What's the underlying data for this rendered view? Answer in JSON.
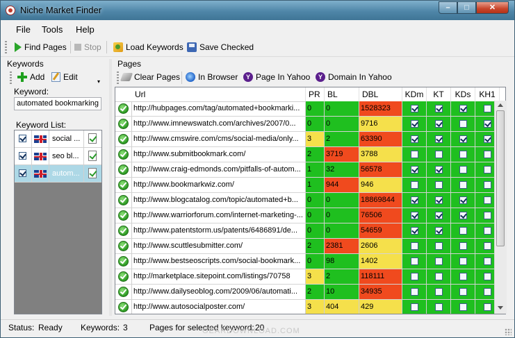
{
  "window": {
    "title": "Niche Market Finder"
  },
  "menu": [
    "File",
    "Tools",
    "Help"
  ],
  "toolbar": {
    "find_pages": "Find Pages",
    "stop": "Stop",
    "load_keywords": "Load Keywords",
    "save_checked": "Save Checked"
  },
  "keywords_panel": {
    "title": "Keywords",
    "add": "Add",
    "edit": "Edit",
    "keyword_label": "Keyword:",
    "keyword_value": "automated bookmarking",
    "list_label": "Keyword List:",
    "items": [
      {
        "text": "social ...",
        "checked": true,
        "selected": false
      },
      {
        "text": "seo bl...",
        "checked": true,
        "selected": false
      },
      {
        "text": "autom...",
        "checked": true,
        "selected": true
      }
    ]
  },
  "pages_panel": {
    "title": "Pages",
    "clear_pages": "Clear Pages",
    "in_browser": "In Browser",
    "page_in_yahoo": "Page In Yahoo",
    "domain_in_yahoo": "Domain In Yahoo",
    "columns": [
      "Url",
      "PR",
      "BL",
      "DBL",
      "KDm",
      "KT",
      "KDs",
      "KH1"
    ],
    "rows": [
      {
        "url": "http://hubpages.com/tag/automated+bookmarki...",
        "pr": "0",
        "bl": "0",
        "dbl": "1528323",
        "c": [
          "g",
          "g",
          "r"
        ],
        "kdm": true,
        "kt": true,
        "kds": true,
        "kh1": false
      },
      {
        "url": "http://www.imnewswatch.com/archives/2007/0...",
        "pr": "0",
        "bl": "0",
        "dbl": "9716",
        "c": [
          "g",
          "g",
          "y"
        ],
        "kdm": true,
        "kt": true,
        "kds": false,
        "kh1": true
      },
      {
        "url": "http://www.cmswire.com/cms/social-media/only...",
        "pr": "3",
        "bl": "2",
        "dbl": "63390",
        "c": [
          "y",
          "g",
          "r"
        ],
        "kdm": true,
        "kt": true,
        "kds": true,
        "kh1": true
      },
      {
        "url": "http://www.submitbookmark.com/",
        "pr": "2",
        "bl": "3719",
        "dbl": "3788",
        "c": [
          "g",
          "r",
          "y"
        ],
        "kdm": false,
        "kt": false,
        "kds": false,
        "kh1": false
      },
      {
        "url": "http://www.craig-edmonds.com/pitfalls-of-autom...",
        "pr": "1",
        "bl": "32",
        "dbl": "56578",
        "c": [
          "g",
          "g",
          "r"
        ],
        "kdm": true,
        "kt": true,
        "kds": false,
        "kh1": false
      },
      {
        "url": "http://www.bookmarkwiz.com/",
        "pr": "1",
        "bl": "944",
        "dbl": "946",
        "c": [
          "g",
          "r",
          "y"
        ],
        "kdm": false,
        "kt": false,
        "kds": false,
        "kh1": false
      },
      {
        "url": "http://www.blogcatalog.com/topic/automated+b...",
        "pr": "0",
        "bl": "0",
        "dbl": "18869844",
        "c": [
          "g",
          "g",
          "r"
        ],
        "kdm": true,
        "kt": true,
        "kds": true,
        "kh1": false
      },
      {
        "url": "http://www.warriorforum.com/internet-marketing-...",
        "pr": "0",
        "bl": "0",
        "dbl": "76506",
        "c": [
          "g",
          "g",
          "r"
        ],
        "kdm": true,
        "kt": true,
        "kds": true,
        "kh1": false
      },
      {
        "url": "http://www.patentstorm.us/patents/6486891/de...",
        "pr": "0",
        "bl": "0",
        "dbl": "54659",
        "c": [
          "g",
          "g",
          "r"
        ],
        "kdm": true,
        "kt": true,
        "kds": false,
        "kh1": false
      },
      {
        "url": "http://www.scuttlesubmitter.com/",
        "pr": "2",
        "bl": "2381",
        "dbl": "2606",
        "c": [
          "g",
          "r",
          "y"
        ],
        "kdm": false,
        "kt": false,
        "kds": false,
        "kh1": false
      },
      {
        "url": "http://www.bestseoscripts.com/social-bookmark...",
        "pr": "0",
        "bl": "98",
        "dbl": "1402",
        "c": [
          "g",
          "g",
          "y"
        ],
        "kdm": false,
        "kt": false,
        "kds": false,
        "kh1": false
      },
      {
        "url": "http://marketplace.sitepoint.com/listings/70758",
        "pr": "3",
        "bl": "2",
        "dbl": "118111",
        "c": [
          "y",
          "g",
          "r"
        ],
        "kdm": false,
        "kt": false,
        "kds": false,
        "kh1": false
      },
      {
        "url": "http://www.dailyseoblog.com/2009/06/automati...",
        "pr": "2",
        "bl": "10",
        "dbl": "34935",
        "c": [
          "g",
          "g",
          "r"
        ],
        "kdm": false,
        "kt": false,
        "kds": false,
        "kh1": false
      },
      {
        "url": "http://www.autosocialposter.com/",
        "pr": "3",
        "bl": "404",
        "dbl": "429",
        "c": [
          "y",
          "y",
          "y"
        ],
        "kdm": false,
        "kt": false,
        "kds": false,
        "kh1": false
      }
    ]
  },
  "status": {
    "status_label": "Status:",
    "status_value": "Ready",
    "keywords_label": "Keywords:",
    "keywords_value": "3",
    "pages_label": "Pages for selected keyword:",
    "pages_value": "20"
  },
  "watermark": "GEARDOWNLOAD.COM"
}
